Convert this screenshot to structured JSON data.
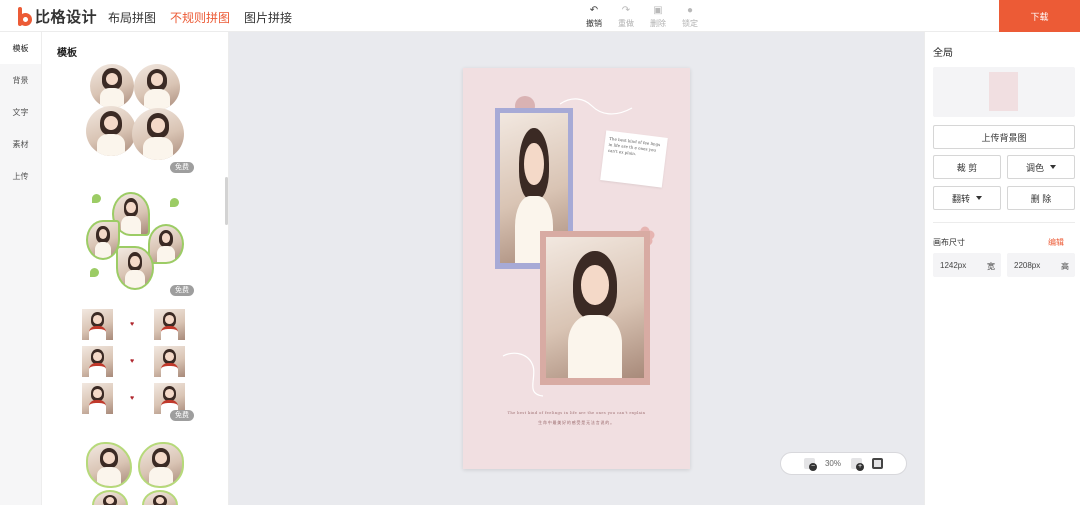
{
  "app": {
    "logo_text": "比格设计"
  },
  "nav": {
    "items": [
      {
        "label": "布局拼图"
      },
      {
        "label": "不规则拼图"
      },
      {
        "label": "图片拼接"
      }
    ],
    "active": "不规则拼图"
  },
  "toolbar": {
    "undo": "撤销",
    "redo": "重做",
    "delete": "删除",
    "lock": "锁定",
    "download": "下载"
  },
  "rail": {
    "items": [
      {
        "label": "模板"
      },
      {
        "label": "背景"
      },
      {
        "label": "文字"
      },
      {
        "label": "素材"
      },
      {
        "label": "上传"
      }
    ]
  },
  "panel": {
    "title": "模板",
    "templates": [
      {
        "badge": "免费"
      },
      {
        "badge": "免费"
      },
      {
        "badge": "免费"
      }
    ]
  },
  "canvas": {
    "note_text": "The best kind of fee lings in life are th e ones you can't ex plain.",
    "quote_en": "The best kind of feelings in life are the ones you can't explain",
    "quote_cn": "生命中最美好的感受是无法言说的。",
    "zoom": "30%"
  },
  "right": {
    "title": "全局",
    "upload_bg": "上传背景图",
    "crop": "裁 剪",
    "color": "调色",
    "flip": "翻转",
    "delete": "删 除",
    "size_label": "画布尺寸",
    "size_edit": "编辑",
    "width_value": "1242px",
    "width_unit": "宽",
    "height_value": "2208px",
    "height_unit": "高",
    "bg_color": "#f1dfe1"
  },
  "colors": {
    "accent": "#ec5b36",
    "canvas_bg": "#e9eaee",
    "frame_lavender": "#a7aad6",
    "frame_rose": "#d8aba3"
  }
}
